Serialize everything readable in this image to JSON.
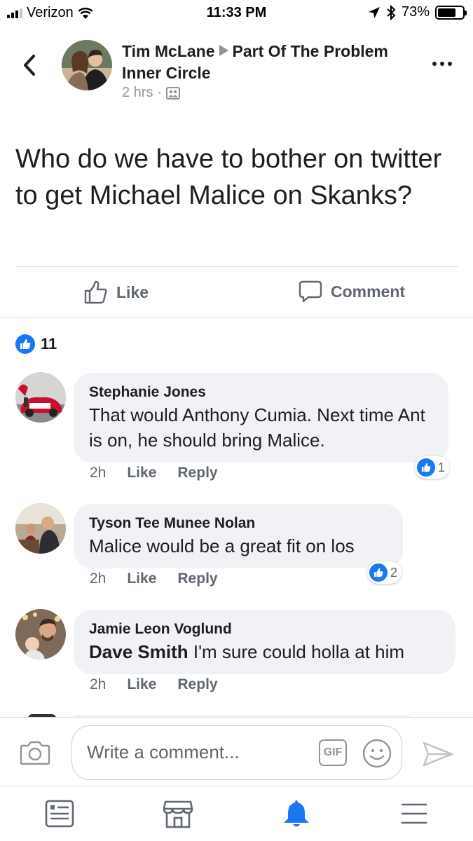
{
  "status_bar": {
    "carrier": "Verizon",
    "time": "11:33 PM",
    "battery": "73%",
    "battery_level": 0.73
  },
  "post": {
    "author": "Tim McLane",
    "group": "Part Of The Problem Inner Circle",
    "time": "2 hrs",
    "privacy_icon": "group-icon",
    "text": "Who do we have to bother on twitter to get Michael Malice on Skanks?",
    "like_label": "Like",
    "comment_label": "Comment",
    "reaction_count": "11"
  },
  "comments": [
    {
      "name": "Stephanie Jones",
      "text": "That would Anthony Cumia. Next time Ant is on, he should bring Malice.",
      "time": "2h",
      "like_label": "Like",
      "reply_label": "Reply",
      "reactions": "1"
    },
    {
      "name": "Tyson Tee Munee Nolan",
      "text": "Malice would be a great fit on los",
      "time": "2h",
      "like_label": "Like",
      "reply_label": "Reply",
      "reactions": "2"
    },
    {
      "name": "Jamie Leon Voglund",
      "mention": "Dave Smith",
      "text": "I'm sure could holla at him",
      "time": "2h",
      "like_label": "Like",
      "reply_label": "Reply"
    }
  ],
  "composer": {
    "placeholder": "Write a comment...",
    "gif_label": "GIF"
  },
  "colors": {
    "accent": "#1877f2",
    "bubble": "#f0f2f5",
    "secondary_text": "#606770"
  }
}
